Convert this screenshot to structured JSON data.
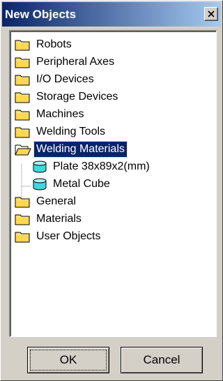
{
  "window": {
    "title": "New Objects",
    "close_icon": "close-icon"
  },
  "tree": {
    "items": [
      {
        "label": "Robots",
        "icon": "folder-icon",
        "selected": false
      },
      {
        "label": "Peripheral Axes",
        "icon": "folder-icon",
        "selected": false
      },
      {
        "label": "I/O Devices",
        "icon": "folder-icon",
        "selected": false
      },
      {
        "label": "Storage Devices",
        "icon": "folder-icon",
        "selected": false
      },
      {
        "label": "Machines",
        "icon": "folder-icon",
        "selected": false
      },
      {
        "label": "Welding Tools",
        "icon": "folder-icon",
        "selected": false
      },
      {
        "label": "Welding Materials",
        "icon": "open-folder-icon",
        "selected": true,
        "expanded": true
      },
      {
        "label": "Plate 38x89x2(mm)",
        "icon": "cylinder-object-icon",
        "selected": false
      },
      {
        "label": "Metal Cube",
        "icon": "cylinder-object-icon",
        "selected": false
      },
      {
        "label": "General",
        "icon": "folder-icon",
        "selected": false
      },
      {
        "label": "Materials",
        "icon": "folder-icon",
        "selected": false
      },
      {
        "label": "User Objects",
        "icon": "folder-icon",
        "selected": false
      }
    ]
  },
  "buttons": {
    "ok_label": "OK",
    "cancel_label": "Cancel"
  },
  "colors": {
    "title_start": "#0a246a",
    "title_end": "#a6caf0",
    "selection": "#0a246a",
    "folder_yellow": "#ffd84f",
    "object_cyan": "#3fd8e0",
    "dialog_face": "#d4d0c8"
  }
}
